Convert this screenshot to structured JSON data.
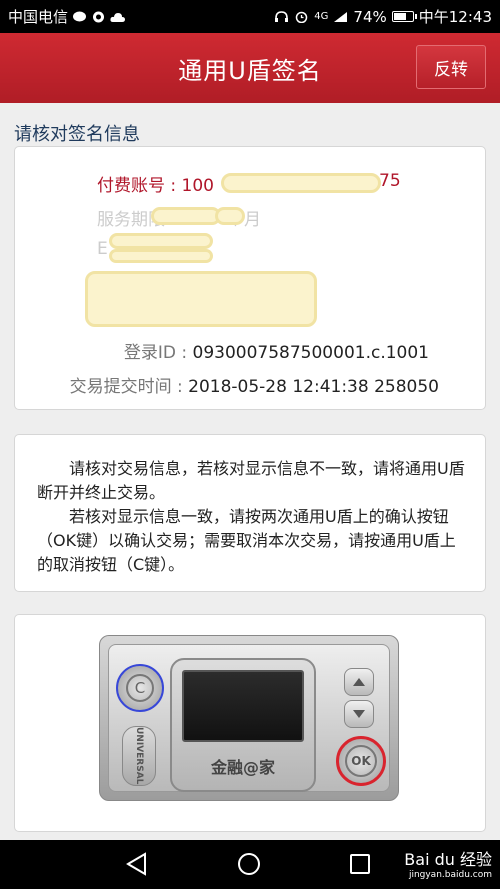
{
  "status_bar": {
    "carrier": "中国电信",
    "signal_label": "4G",
    "battery_percent": 74,
    "battery_text": "74%",
    "time": "中午12:43"
  },
  "header": {
    "title": "通用U盾签名",
    "flip_label": "反转"
  },
  "section_title": "请核对签名信息",
  "sign_info": {
    "account_label": "付费账号 : ",
    "account_value": "100",
    "account_tail": "75",
    "ghost_service": "服务期限",
    "ghost_month": "个月",
    "ghost_e": "E",
    "login_label": "登录ID : ",
    "login_value": "0930007587500001.c.1001",
    "time_label": "交易提交时间 : ",
    "time_value": "2018-05-28 12:41:38 258050"
  },
  "notice": {
    "para1": "请核对交易信息，若核对显示信息不一致，请将通用U盾断开并终止交易。",
    "para2": "若核对显示信息一致，请按两次通用U盾上的确认按钮（OK键）以确认交易；需要取消本次交易，请按通用U盾上的取消按钮（C键）。"
  },
  "device": {
    "c_key": "C",
    "brand": "UNIVERSAL",
    "screen_label": "金融@家",
    "ok_key": "OK"
  },
  "watermark": {
    "main": "Bai du 经验",
    "sub": "jingyan.baidu.com"
  }
}
